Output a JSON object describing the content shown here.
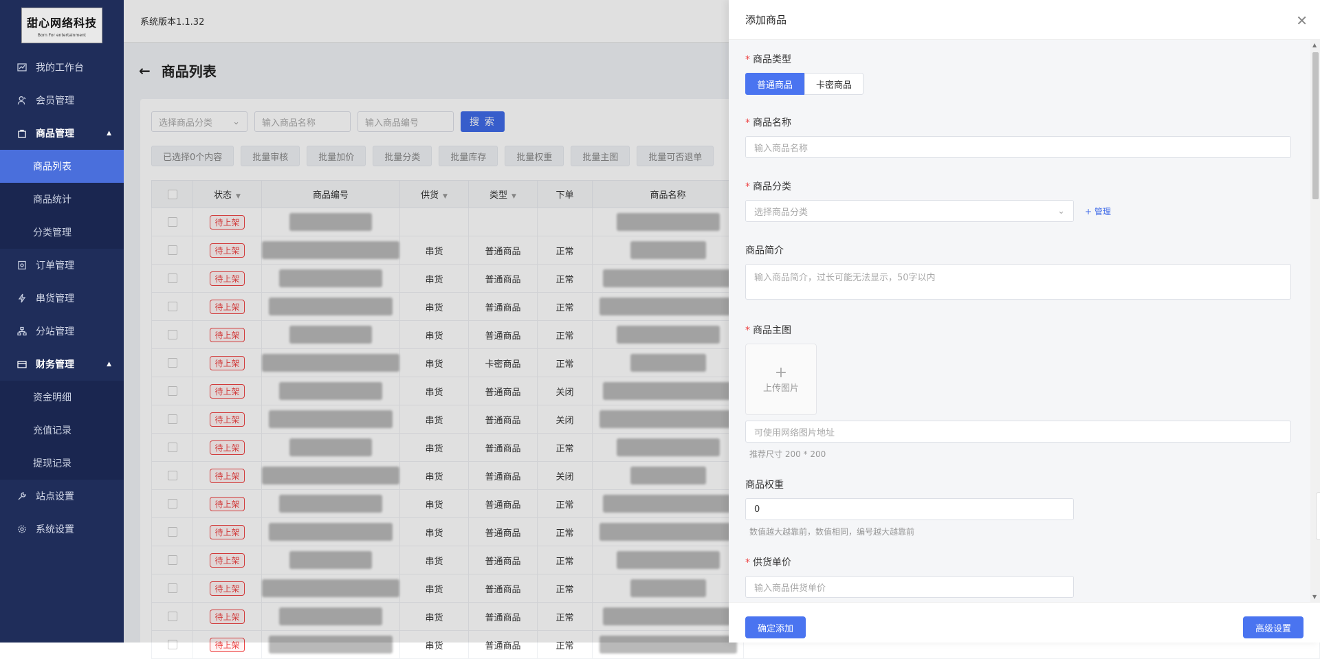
{
  "logo": {
    "title": "甜心网络科技",
    "subtitle": "Born For entertainment"
  },
  "sidebar": {
    "items": [
      {
        "label": "我的工作台",
        "icon": "chart-icon"
      },
      {
        "label": "会员管理",
        "icon": "user-icon"
      },
      {
        "label": "商品管理",
        "icon": "bag-icon",
        "open": true,
        "children": [
          "商品列表",
          "商品统计",
          "分类管理"
        ]
      },
      {
        "label": "订单管理",
        "icon": "order-icon"
      },
      {
        "label": "串货管理",
        "icon": "bolt-icon"
      },
      {
        "label": "分站管理",
        "icon": "branch-icon"
      },
      {
        "label": "财务管理",
        "icon": "wallet-icon",
        "open": true,
        "children": [
          "资金明细",
          "充值记录",
          "提现记录"
        ]
      },
      {
        "label": "站点设置",
        "icon": "wrench-icon"
      },
      {
        "label": "系统设置",
        "icon": "gear-icon"
      }
    ]
  },
  "header": {
    "version": "系统版本1.1.32"
  },
  "page": {
    "title": "商品列表"
  },
  "filters": {
    "category_placeholder": "选择商品分类",
    "name_placeholder": "输入商品名称",
    "code_placeholder": "输入商品编号",
    "search_label": "搜 索"
  },
  "bulk": [
    "已选择0个内容",
    "批量审核",
    "批量加价",
    "批量分类",
    "批量库存",
    "批量权重",
    "批量主图",
    "批量可否退单"
  ],
  "table": {
    "headers": [
      "状态",
      "商品编号",
      "供货",
      "类型",
      "下单",
      "商品名称"
    ],
    "rows": [
      {
        "status": "待上架",
        "supply": "",
        "type": "",
        "order": ""
      },
      {
        "status": "待上架",
        "supply": "串货",
        "type": "普通商品",
        "order": "正常"
      },
      {
        "status": "待上架",
        "supply": "串货",
        "type": "普通商品",
        "order": "正常"
      },
      {
        "status": "待上架",
        "supply": "串货",
        "type": "普通商品",
        "order": "正常"
      },
      {
        "status": "待上架",
        "supply": "串货",
        "type": "普通商品",
        "order": "正常"
      },
      {
        "status": "待上架",
        "supply": "串货",
        "type": "卡密商品",
        "order": "正常"
      },
      {
        "status": "待上架",
        "supply": "串货",
        "type": "普通商品",
        "order": "关闭"
      },
      {
        "status": "待上架",
        "supply": "串货",
        "type": "普通商品",
        "order": "关闭"
      },
      {
        "status": "待上架",
        "supply": "串货",
        "type": "普通商品",
        "order": "正常"
      },
      {
        "status": "待上架",
        "supply": "串货",
        "type": "普通商品",
        "order": "关闭"
      },
      {
        "status": "待上架",
        "supply": "串货",
        "type": "普通商品",
        "order": "正常"
      },
      {
        "status": "待上架",
        "supply": "串货",
        "type": "普通商品",
        "order": "正常"
      },
      {
        "status": "待上架",
        "supply": "串货",
        "type": "普通商品",
        "order": "正常"
      },
      {
        "status": "待上架",
        "supply": "串货",
        "type": "普通商品",
        "order": "正常"
      },
      {
        "status": "待上架",
        "supply": "串货",
        "type": "普通商品",
        "order": "正常"
      },
      {
        "status": "待上架",
        "supply": "串货",
        "type": "普通商品",
        "order": "正常"
      }
    ]
  },
  "drawer": {
    "title": "添加商品",
    "type_label": "商品类型",
    "type_options": [
      "普通商品",
      "卡密商品"
    ],
    "name_label": "商品名称",
    "name_placeholder": "输入商品名称",
    "cat_label": "商品分类",
    "cat_placeholder": "选择商品分类",
    "cat_manage": "+ 管理",
    "intro_label": "商品简介",
    "intro_placeholder": "输入商品简介，过长可能无法显示，50字以内",
    "img_label": "商品主图",
    "upload_label": "上传图片",
    "img_url_placeholder": "可使用网络图片地址",
    "img_hint": "推荐尺寸 200 * 200",
    "weight_label": "商品权重",
    "weight_value": "0",
    "weight_hint": "数值越大越靠前，数值相同，编号越大越靠前",
    "price_label": "供货单价",
    "price_placeholder": "输入商品供货单价",
    "confirm_label": "确定添加",
    "advanced_label": "高级设置"
  },
  "colors": {
    "sidebar": "#1f2d5a",
    "accent": "#4a74f0",
    "danger": "#ee4444"
  }
}
